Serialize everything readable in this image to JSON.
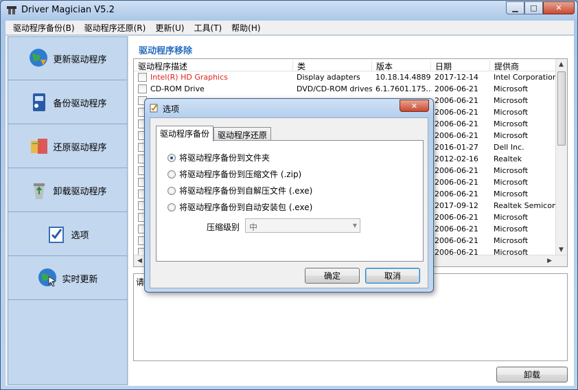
{
  "window": {
    "title": "Driver Magician V5.2",
    "min": "▁",
    "max": "□",
    "close": "✕"
  },
  "menu": [
    "驱动程序备份(B)",
    "驱动程序还原(R)",
    "更新(U)",
    "工具(T)",
    "帮助(H)"
  ],
  "sidebar": {
    "items": [
      {
        "label": "更新驱动程序",
        "icon": "globe-update-icon"
      },
      {
        "label": "备份驱动程序",
        "icon": "backup-icon"
      },
      {
        "label": "还原驱动程序",
        "icon": "restore-icon"
      },
      {
        "label": "卸载驱动程序",
        "icon": "recycle-bin-icon"
      },
      {
        "label": "选项",
        "icon": "options-checklist-icon"
      },
      {
        "label": "实时更新",
        "icon": "live-update-globe-icon"
      }
    ]
  },
  "main": {
    "section_title": "驱动程序移除",
    "columns": [
      "驱动程序描述",
      "类",
      "版本",
      "日期",
      "提供商"
    ],
    "rows": [
      {
        "desc": "Intel(R) HD Graphics",
        "class": "Display adapters",
        "version": "10.18.14.4889",
        "date": "2017-12-14",
        "provider": "Intel Corporation",
        "highlight": true
      },
      {
        "desc": "CD-ROM Drive",
        "class": "DVD/CD-ROM drives",
        "version": "6.1.7601.175...",
        "date": "2006-06-21",
        "provider": "Microsoft"
      },
      {
        "desc": "",
        "class": "",
        "version": "",
        "date": "2006-06-21",
        "provider": "Microsoft"
      },
      {
        "desc": "",
        "class": "",
        "version": "",
        "date": "2006-06-21",
        "provider": "Microsoft"
      },
      {
        "desc": "",
        "class": "",
        "version": "",
        "date": "2006-06-21",
        "provider": "Microsoft"
      },
      {
        "desc": "",
        "class": "",
        "version": "",
        "date": "2006-06-21",
        "provider": "Microsoft"
      },
      {
        "desc": "",
        "class": "",
        "version": "",
        "date": "2016-01-27",
        "provider": "Dell Inc."
      },
      {
        "desc": "",
        "class": "",
        "version": "",
        "date": "2012-02-16",
        "provider": "Realtek"
      },
      {
        "desc": "",
        "class": "",
        "version": "",
        "date": "2006-06-21",
        "provider": "Microsoft"
      },
      {
        "desc": "",
        "class": "",
        "version": "",
        "date": "2006-06-21",
        "provider": "Microsoft"
      },
      {
        "desc": "",
        "class": "",
        "version": "",
        "date": "2006-06-21",
        "provider": "Microsoft"
      },
      {
        "desc": "",
        "class": "",
        "version": "",
        "date": "2017-09-12",
        "provider": "Realtek Semicondu"
      },
      {
        "desc": "",
        "class": "",
        "version": "",
        "date": "2006-06-21",
        "provider": "Microsoft"
      },
      {
        "desc": "",
        "class": "",
        "version": "",
        "date": "2006-06-21",
        "provider": "Microsoft"
      },
      {
        "desc": "",
        "class": "",
        "version": "",
        "date": "2006-06-21",
        "provider": "Microsoft"
      },
      {
        "desc": "",
        "class": "",
        "version": "",
        "date": "2006-06-21",
        "provider": "Microsoft"
      }
    ],
    "log_text": "请",
    "uninstall_label": "卸载"
  },
  "dialog": {
    "title": "选项",
    "close": "✕",
    "tabs": [
      "驱动程序备份",
      "驱动程序还原"
    ],
    "options": [
      {
        "label": "将驱动程序备份到文件夹",
        "selected": true
      },
      {
        "label": "将驱动程序备份到压缩文件 (.zip)",
        "selected": false
      },
      {
        "label": "将驱动程序备份到自解压文件 (.exe)",
        "selected": false
      },
      {
        "label": "将驱动程序备份到自动安装包 (.exe)",
        "selected": false
      }
    ],
    "compression_label": "压缩级别",
    "compression_value": "中",
    "ok_label": "确定",
    "cancel_label": "取消"
  },
  "colors": {
    "accent": "#2b6fc0",
    "highlight_text": "#e0201a",
    "sidebar_bg": "#c3d7ee"
  }
}
